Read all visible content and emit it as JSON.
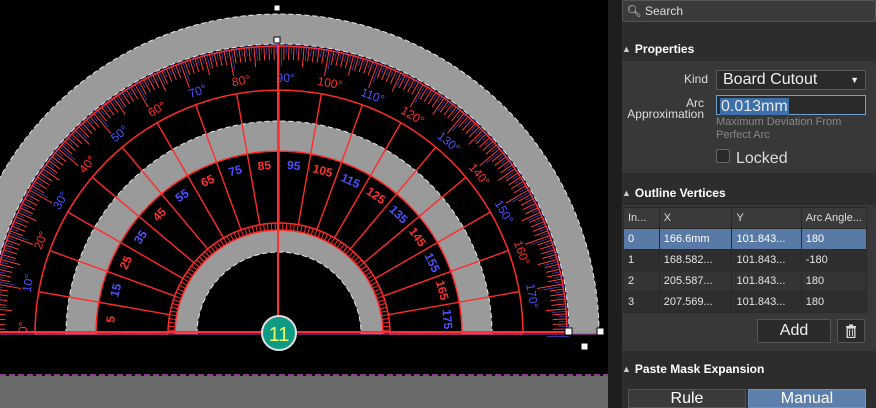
{
  "search": {
    "placeholder": "Search"
  },
  "properties": {
    "title": "Properties",
    "kind_label": "Kind",
    "kind_value": "Board Cutout",
    "arc_label_1": "Arc",
    "arc_label_2": "Approximation",
    "arc_value": "0.013mm",
    "arc_hint": "Maximum Deviation From Perfect Arc",
    "locked_label": "Locked",
    "locked_checked": false
  },
  "outline": {
    "title": "Outline Vertices",
    "columns": [
      "In...",
      "X",
      "Y",
      "Arc Angle..."
    ],
    "rows": [
      [
        "0",
        "166.6mm",
        "101.843...",
        "180"
      ],
      [
        "1",
        "168.582...",
        "101.843...",
        "-180"
      ],
      [
        "2",
        "205.587...",
        "101.843...",
        "180"
      ],
      [
        "3",
        "207.569...",
        "101.843...",
        "180"
      ]
    ],
    "add_label": "Add",
    "delete_icon": "trash-icon"
  },
  "paste_mask": {
    "title": "Paste Mask Expansion",
    "options": [
      "Rule",
      "Manual"
    ],
    "selected": "Manual"
  },
  "canvas": {
    "outer_scale_labels": [
      "0°",
      "10°",
      "20°",
      "30°",
      "40°",
      "50°",
      "60°",
      "70°",
      "80°",
      "90°",
      "100°",
      "110°",
      "120°",
      "130°",
      "140°",
      "150°",
      "160°",
      "170°"
    ],
    "inner_scale_labels": [
      "5",
      "15",
      "25",
      "35",
      "45",
      "55",
      "65",
      "75",
      "85",
      "95",
      "105",
      "115",
      "125",
      "135",
      "145",
      "155",
      "165",
      "175"
    ],
    "center_badge": "11",
    "colors": {
      "cutout": "#9a9a9a",
      "ticks_red": "#ff2b2b",
      "ticks_blue": "#3b3bff",
      "badge": "#0f9a86"
    }
  }
}
